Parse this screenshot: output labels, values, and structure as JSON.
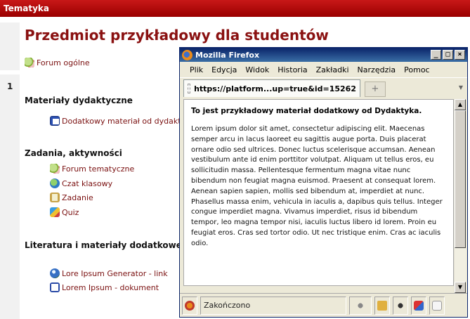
{
  "page": {
    "topbar_title": "Tematyka",
    "course_title": "Przedmiot przykładowy dla studentów",
    "general_forum": "Forum ogólne",
    "week_number": "1",
    "sections": [
      {
        "title": "Materiały dydaktyczne",
        "items": [
          {
            "label": "Dodatkowy materiał od dydaktyka",
            "icon": "page-icon"
          }
        ]
      },
      {
        "title": "Zadania, aktywności",
        "items": [
          {
            "label": "Forum tematyczne",
            "icon": "forum-icon"
          },
          {
            "label": "Czat klasowy",
            "icon": "chat-icon"
          },
          {
            "label": "Zadanie",
            "icon": "assignment-icon"
          },
          {
            "label": "Quiz",
            "icon": "quiz-icon"
          }
        ]
      },
      {
        "title": "Literatura i materiały dodatkowe",
        "items": [
          {
            "label": "Lore Ipsum Generator - link",
            "icon": "link-icon"
          },
          {
            "label": "Lorem Ipsum - dokument",
            "icon": "document-icon"
          }
        ]
      }
    ]
  },
  "firefox": {
    "window_title": "Mozilla Firefox",
    "menu": [
      "Plik",
      "Edycja",
      "Widok",
      "Historia",
      "Zakładki",
      "Narzędzia",
      "Pomoc"
    ],
    "tab_title": "https://platform...up=true&id=15262",
    "content_heading": "To jest przykładowy materiał dodatkowy od Dydaktyka.",
    "content_text": "Lorem ipsum dolor sit amet, consectetur adipiscing elit. Maecenas semper arcu in lacus laoreet eu sagittis augue porta. Duis placerat ornare odio sed ultrices. Donec luctus scelerisque accumsan. Aenean vestibulum ante id enim porttitor volutpat. Aliquam ut tellus eros, eu sollicitudin massa. Pellentesque fermentum magna vitae nunc bibendum non feugiat magna euismod. Praesent at consequat lorem. Aenean sapien sapien, mollis sed bibendum at, imperdiet at nunc. Phasellus massa enim, vehicula in iaculis a, dapibus quis tellus. Integer congue imperdiet magna. Vivamus imperdiet, risus id bibendum tempor, leo magna tempor nisi, iaculis luctus libero id lorem. Proin eu feugiat eros. Cras sed tortor odio. Ut nec tristique enim. Cras ac iaculis odio.",
    "status_text": "Zakończono"
  }
}
